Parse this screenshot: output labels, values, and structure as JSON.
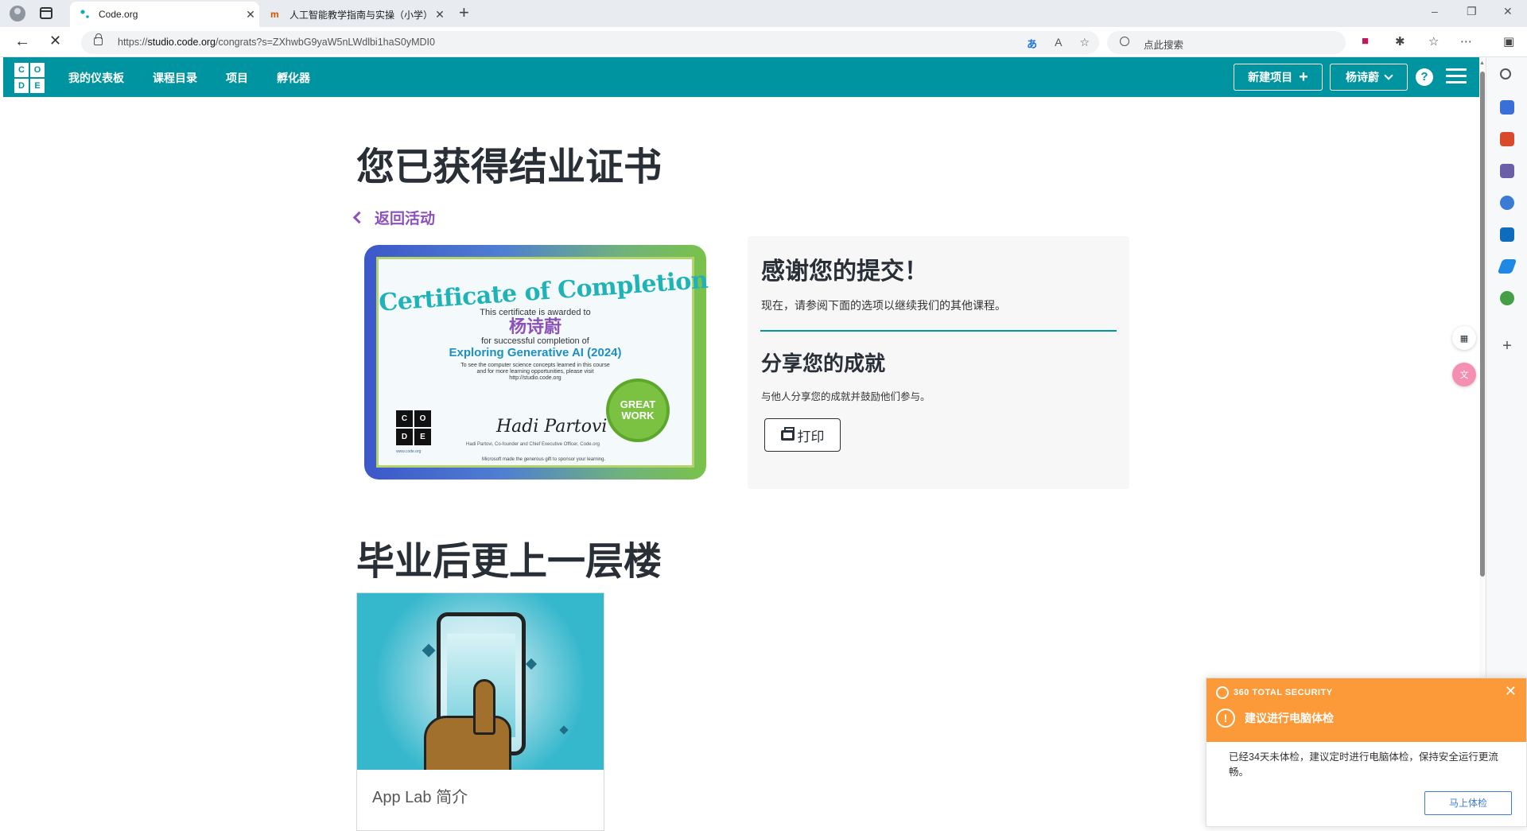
{
  "browser": {
    "tabs": [
      {
        "title": "Code.org",
        "active": true
      },
      {
        "title": "人工智能教学指南与实操（小学）",
        "active": false
      }
    ],
    "url_prefix": "https://",
    "url_host": "studio.code.org",
    "url_path": "/congrats?s=ZXhwbG9yaW5nLWdlbi1haS0yMDI0",
    "translate_icon": "あ",
    "read_aloud_icon": "A",
    "search_placeholder": "点此搜索",
    "new_tab": "+",
    "min": "–",
    "max": "❐",
    "close": "✕"
  },
  "header": {
    "logo_letters": [
      "C",
      "O",
      "D",
      "E"
    ],
    "nav": [
      "我的仪表板",
      "课程目录",
      "项目",
      "孵化器"
    ],
    "new_project": "新建项目",
    "new_project_icon": "+",
    "user_name": "杨诗蔚",
    "help": "?"
  },
  "main": {
    "title": "您已获得结业证书",
    "back_link": "返回活动",
    "certificate": {
      "heading": "Certificate of Completion",
      "awarded": "This certificate is awarded to",
      "name": "杨诗蔚",
      "for": "for successful completion of",
      "course": "Exploring Generative AI (2024)",
      "info1": "To see the computer science concepts learned in this course",
      "info2": "and for more learning opportunities, please visit",
      "info3": "http://studio.code.org",
      "signature": "Hadi Partovi",
      "signer": "Hadi Partovi, Co-founder and Chief Executive Officer, Code.org",
      "badge_line1": "GREAT",
      "badge_line2": "WORK",
      "footer": "Microsoft made the generous gift to sponsor your learning.",
      "site": "www.code.org"
    },
    "thanks_title": "感谢您的提交！",
    "thanks_sub": "现在，请参阅下面的选项以继续我们的其他课程。",
    "share_title": "分享您的成就",
    "share_sub": "与他人分享您的成就并鼓励他们参与。",
    "print_label": "打印",
    "beyond_title": "毕业后更上一层楼",
    "card_title": "App Lab 简介"
  },
  "notification": {
    "brand": "360 TOTAL SECURITY",
    "title": "建议进行电脑体检",
    "warn_icon": "!",
    "body": "已经34天未体检，建议定时进行电脑体检，保持安全运行更流畅。",
    "button": "马上体检",
    "close": "✕"
  },
  "colors": {
    "header_teal": "#0094a0",
    "link_purple": "#8c52ba",
    "notif_orange": "#fc9a3a"
  }
}
